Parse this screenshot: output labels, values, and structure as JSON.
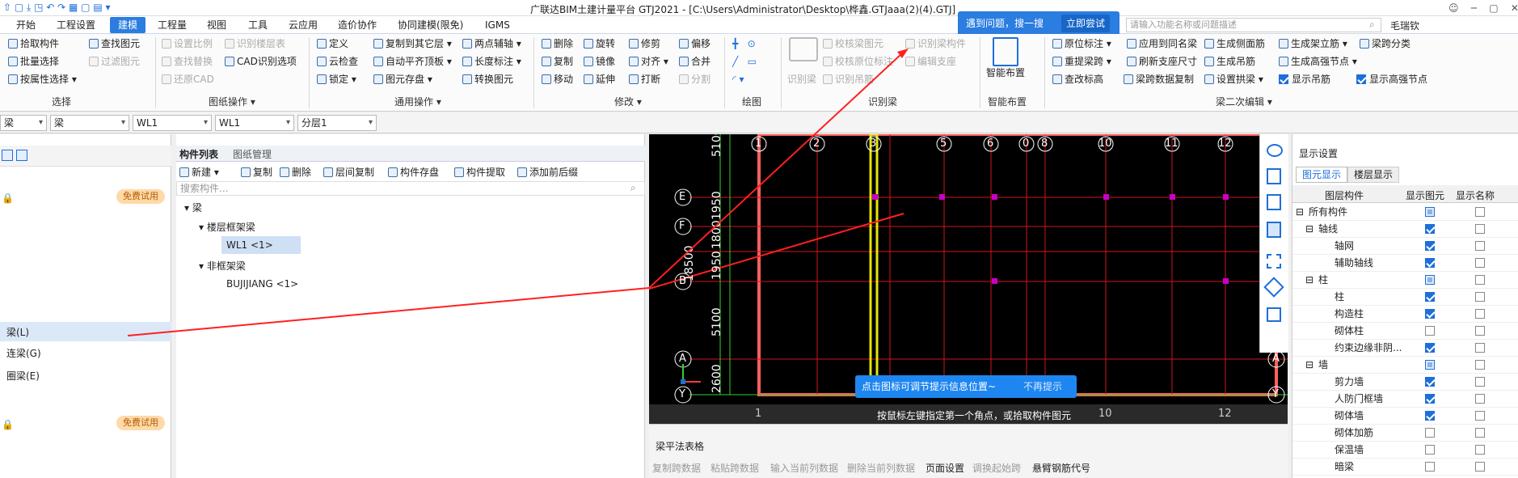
{
  "title_bar": {
    "title": "广联达BIM土建计量平台 GTJ2021 - [C:\\Users\\Administrator\\Desktop\\桦鑫.GTJaaa(2)(4).GTJ]",
    "user": "毛瑞钦"
  },
  "menu": [
    "开始",
    "工程设置",
    "建模",
    "工程量",
    "视图",
    "工具",
    "云应用",
    "造价协作",
    "协同建模(限免)",
    "IGMS"
  ],
  "active_menu": "建模",
  "search": {
    "banner_text": "遇到问题，搜一搜",
    "banner_button": "立即尝试",
    "placeholder": "请输入功能名称或问题描述"
  },
  "ribbon": {
    "select": {
      "items": [
        "拾取构件",
        "批量选择",
        "按属性选择",
        "查找图元",
        "过滤图元"
      ],
      "label": "选择"
    },
    "drawing_ops": {
      "items": [
        "设置比例",
        "识别楼层表",
        "查找替换",
        "CAD识别选项",
        "还原CAD"
      ],
      "label": "图纸操作"
    },
    "general": {
      "items": [
        "定义",
        "复制到其它层",
        "两点辅轴",
        "云检查",
        "自动平齐顶板",
        "长度标注",
        "锁定",
        "图元存盘",
        "转换图元"
      ],
      "label": "通用操作"
    },
    "modify": {
      "items": [
        "删除",
        "旋转",
        "修剪",
        "偏移",
        "复制",
        "镜像",
        "对齐",
        "合并",
        "移动",
        "延伸",
        "打断",
        "分割"
      ],
      "label": "修改"
    },
    "draw": {
      "label": "绘图"
    },
    "recognize": {
      "items": [
        "识别梁",
        "校核梁图元",
        "识别梁构件",
        "校核原位标注",
        "编辑支座",
        "识别吊筋"
      ],
      "label": "识别梁"
    },
    "smart": {
      "button": "智能布置",
      "label": "智能布置"
    },
    "beam_edit": {
      "items": [
        "原位标注",
        "应用到同名梁",
        "生成侧面筋",
        "生成架立筋",
        "梁跨分类",
        "重提梁跨",
        "刷新支座尺寸",
        "生成吊筋",
        "生成高强节点",
        "查改标高",
        "梁跨数据复制",
        "设置拱梁",
        "显示吊筋",
        "显示高强节点"
      ],
      "label": "梁二次编辑"
    }
  },
  "filters": [
    "梁",
    "梁",
    "WL1",
    "分层1"
  ],
  "left_panel": {
    "free_trial": "免费试用",
    "items": [
      "梁(L)",
      "连梁(G)",
      "圈梁(E)"
    ],
    "free_trial2": "免费试用"
  },
  "component_list": {
    "tabs": [
      "构件列表",
      "图纸管理"
    ],
    "toolbar": [
      "新建",
      "复制",
      "删除",
      "层间复制",
      "构件存盘",
      "构件提取",
      "添加前后缀"
    ],
    "search_placeholder": "搜索构件...",
    "tree": {
      "root": "梁",
      "group1": "楼层框架梁",
      "item1": "WL1 <1>",
      "group2": "非框架梁",
      "item2": "BUJIJIANG <1>"
    }
  },
  "canvas": {
    "axis_top": [
      "1",
      "2",
      "3",
      "5",
      "6",
      "0",
      "8",
      "10",
      "11",
      "12"
    ],
    "axis_left": [
      "E",
      "E",
      "F",
      "B",
      "A",
      "Y"
    ],
    "axis_bottom": [
      "1",
      "10",
      "12"
    ],
    "dims": [
      "5100",
      "1950",
      "1800",
      "1950",
      "5100",
      "2600",
      "18500"
    ],
    "status_hint": "按鼠标左键指定第一个角点，或拾取构件图元",
    "tip": {
      "text": "点击图标可调节提示信息位置~",
      "dismiss": "不再提示"
    }
  },
  "bottom_panel": {
    "title": "梁平法表格",
    "toolbar": [
      "复制跨数据",
      "粘贴跨数据",
      "输入当前列数据",
      "删除当前列数据",
      "页面设置",
      "调换起始跨",
      "悬臂钢筋代号"
    ]
  },
  "display_settings": {
    "title": "显示设置",
    "tabs": [
      "图元显示",
      "楼层显示"
    ],
    "columns": [
      "图层构件",
      "显示图元",
      "显示名称"
    ],
    "rows": [
      {
        "name": "所有构件",
        "level": 0,
        "show": "part",
        "name_on": false
      },
      {
        "name": "轴线",
        "level": 1,
        "show": "on",
        "name_on": false
      },
      {
        "name": "轴网",
        "level": 2,
        "show": "on",
        "name_on": false
      },
      {
        "name": "辅助轴线",
        "level": 2,
        "show": "on",
        "name_on": false
      },
      {
        "name": "柱",
        "level": 1,
        "show": "part",
        "name_on": false
      },
      {
        "name": "柱",
        "level": 2,
        "show": "on",
        "name_on": false
      },
      {
        "name": "构造柱",
        "level": 2,
        "show": "on",
        "name_on": false
      },
      {
        "name": "砌体柱",
        "level": 2,
        "show": "off",
        "name_on": false
      },
      {
        "name": "约束边缘非阴...",
        "level": 2,
        "show": "on",
        "name_on": false
      },
      {
        "name": "墙",
        "level": 1,
        "show": "part",
        "name_on": false
      },
      {
        "name": "剪力墙",
        "level": 2,
        "show": "on",
        "name_on": false
      },
      {
        "name": "人防门框墙",
        "level": 2,
        "show": "on",
        "name_on": false
      },
      {
        "name": "砌体墙",
        "level": 2,
        "show": "on",
        "name_on": false
      },
      {
        "name": "砌体加筋",
        "level": 2,
        "show": "off",
        "name_on": false
      },
      {
        "name": "保温墙",
        "level": 2,
        "show": "off",
        "name_on": false
      },
      {
        "name": "暗梁",
        "level": 2,
        "show": "off",
        "name_on": false
      }
    ]
  }
}
